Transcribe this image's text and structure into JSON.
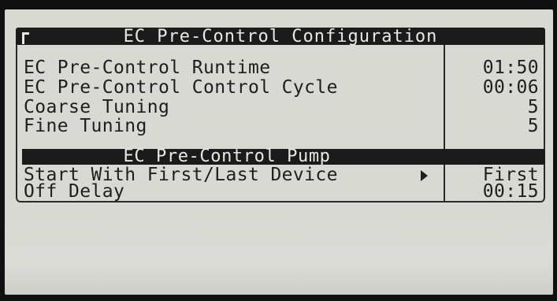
{
  "screen": {
    "title": "EC Pre-Control Configuration",
    "rows": [
      {
        "label": "EC Pre-Control Runtime",
        "value": "01:50"
      },
      {
        "label": "EC Pre-Control Control Cycle",
        "value": "00:06"
      },
      {
        "label": "Coarse Tuning",
        "value": "5"
      },
      {
        "label": "Fine Tuning",
        "value": "5"
      }
    ],
    "section": {
      "title": "EC Pre-Control Pump"
    },
    "pump_rows": [
      {
        "label": "Start With First/Last Device",
        "value": "First"
      },
      {
        "label": "Off Delay",
        "value": "00:15"
      }
    ],
    "icons": {
      "arrow": "right-arrow-icon"
    }
  }
}
